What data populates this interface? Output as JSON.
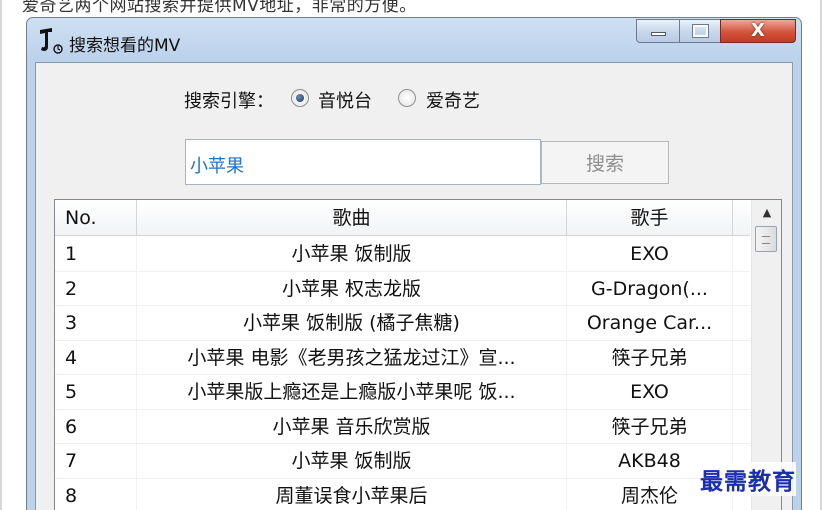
{
  "page": {
    "intro_text": "爱奇艺两个网站搜索并提供MV地址，非常的方便。"
  },
  "window": {
    "title": "搜索想看的MV",
    "icon": "app-icon",
    "buttons": {
      "minimize": "minimize-icon",
      "maximize": "maximize-icon",
      "close": "X"
    }
  },
  "search": {
    "engine_label": "搜索引擎：",
    "engines": [
      {
        "label": "音悦台",
        "selected": true
      },
      {
        "label": "爱奇艺",
        "selected": false
      }
    ],
    "query": "小苹果",
    "button_label": "搜索"
  },
  "results": {
    "columns": [
      "No.",
      "歌曲",
      "歌手"
    ],
    "rows": [
      {
        "no": "1",
        "song": "小苹果 饭制版",
        "artist": "EXO"
      },
      {
        "no": "2",
        "song": "小苹果 权志龙版",
        "artist": "G-Dragon(..."
      },
      {
        "no": "3",
        "song": "小苹果 饭制版 (橘子焦糖)",
        "artist": "Orange Car..."
      },
      {
        "no": "4",
        "song": "小苹果 电影《老男孩之猛龙过江》宣...",
        "artist": "筷子兄弟"
      },
      {
        "no": "5",
        "song": "小苹果版上瘾还是上瘾版小苹果呢 饭...",
        "artist": "EXO"
      },
      {
        "no": "6",
        "song": "小苹果 音乐欣赏版",
        "artist": "筷子兄弟"
      },
      {
        "no": "7",
        "song": "小苹果 饭制版",
        "artist": "AKB48"
      },
      {
        "no": "8",
        "song": "周董误食小苹果后",
        "artist": "周杰伦"
      }
    ]
  },
  "watermark": "最需教育"
}
